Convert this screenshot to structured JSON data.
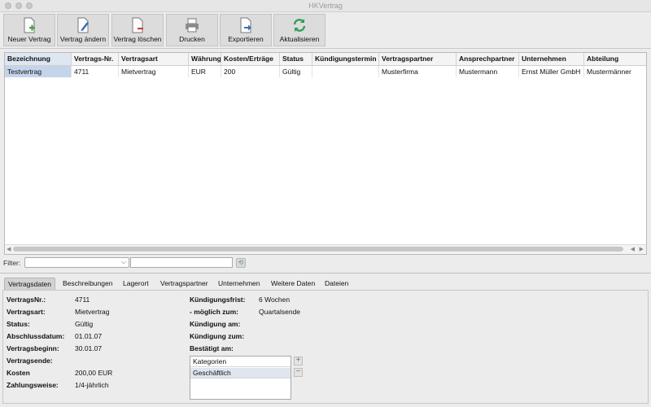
{
  "window": {
    "title": "HKVertrag"
  },
  "toolbar": {
    "buttons": [
      {
        "label": "Neuer Vertrag",
        "icon": "new-document-icon"
      },
      {
        "label": "Vertrag ändern",
        "icon": "edit-document-icon"
      },
      {
        "label": "Vertrag löschen",
        "icon": "delete-document-icon"
      },
      {
        "label": "Drucken",
        "icon": "printer-icon"
      },
      {
        "label": "Exportieren",
        "icon": "export-icon"
      },
      {
        "label": "Aktualisieren",
        "icon": "refresh-icon"
      }
    ]
  },
  "table": {
    "columns": [
      "Bezeichnung",
      "Vertrags-Nr.",
      "Vertragsart",
      "Währung",
      "Kosten/Erträge",
      "Status",
      "Kündigungstermin",
      "Vertragspartner",
      "Ansprechpartner",
      "Unternehmen",
      "Abteilung"
    ],
    "rows": [
      [
        "Testvertrag",
        "4711",
        "Mietvertrag",
        "EUR",
        "200",
        "Gültig",
        "",
        "Musterfirma",
        "Mustermann",
        "Ernst Müller GmbH",
        "Mustermänner"
      ]
    ]
  },
  "filter": {
    "label": "Filter:",
    "select_value": "",
    "input_value": ""
  },
  "tabs": [
    "Vertragsdaten",
    "Beschreibungen",
    "Lagerort",
    "Vertragspartner",
    "Unternehmen",
    "Weitere Daten",
    "Dateien"
  ],
  "details": {
    "left": [
      {
        "label": "VertragsNr.:",
        "value": "4711"
      },
      {
        "label": "Vertragsart:",
        "value": "Mietvertrag"
      },
      {
        "label": "Status:",
        "value": "Gültig"
      },
      {
        "label": "Abschlussdatum:",
        "value": "01.01.07"
      },
      {
        "label": "Vertragsbeginn:",
        "value": "30.01.07"
      },
      {
        "label": "Vertragsende:",
        "value": ""
      },
      {
        "label": "Kosten",
        "value": "200,00 EUR"
      },
      {
        "label": "Zahlungsweise:",
        "value": "1/4-jährlich"
      }
    ],
    "right": [
      {
        "label": "Kündigungsfrist:",
        "value": "6 Wochen"
      },
      {
        "label": "- möglich zum:",
        "value": "Quartalsende"
      },
      {
        "label": "Kündigung am:",
        "value": ""
      },
      {
        "label": "Kündigung zum:",
        "value": ""
      },
      {
        "label": "Bestätigt am:",
        "value": ""
      }
    ],
    "categories": [
      "Kategorien",
      "Geschäftlich"
    ]
  }
}
